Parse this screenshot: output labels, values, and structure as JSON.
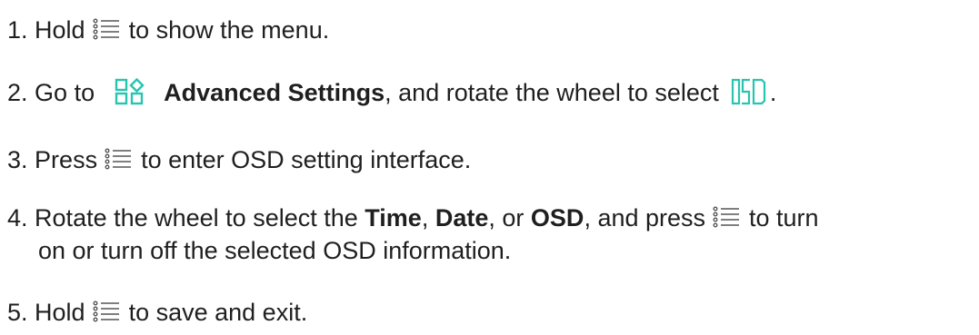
{
  "steps": [
    {
      "num": "1.",
      "text_a": "Hold",
      "text_b": "to show the menu."
    },
    {
      "num": "2.",
      "text_a": "Go to",
      "bold": "Advanced Settings",
      "text_b": ", and rotate the wheel to select",
      "text_c": "."
    },
    {
      "num": "3.",
      "text_a": "Press",
      "text_b": "to enter OSD setting interface."
    },
    {
      "num": "4.",
      "text_a": "Rotate the wheel to select the",
      "bold_1": "Time",
      "sep_1": ",",
      "bold_2": "Date",
      "sep_2": ", or",
      "bold_3": "OSD",
      "text_b": ", and press",
      "text_c": "to turn",
      "line_2": "on or turn off the selected OSD information."
    },
    {
      "num": "5.",
      "text_a": "Hold",
      "text_b": "to save and exit."
    }
  ],
  "icons": {
    "menu": "menu-list-icon",
    "advanced": "advanced-settings-icon",
    "osd": "osd-icon"
  },
  "colors": {
    "accent": "#29c4b0",
    "icon_gray": "#555555",
    "text": "#1f1f1f"
  }
}
